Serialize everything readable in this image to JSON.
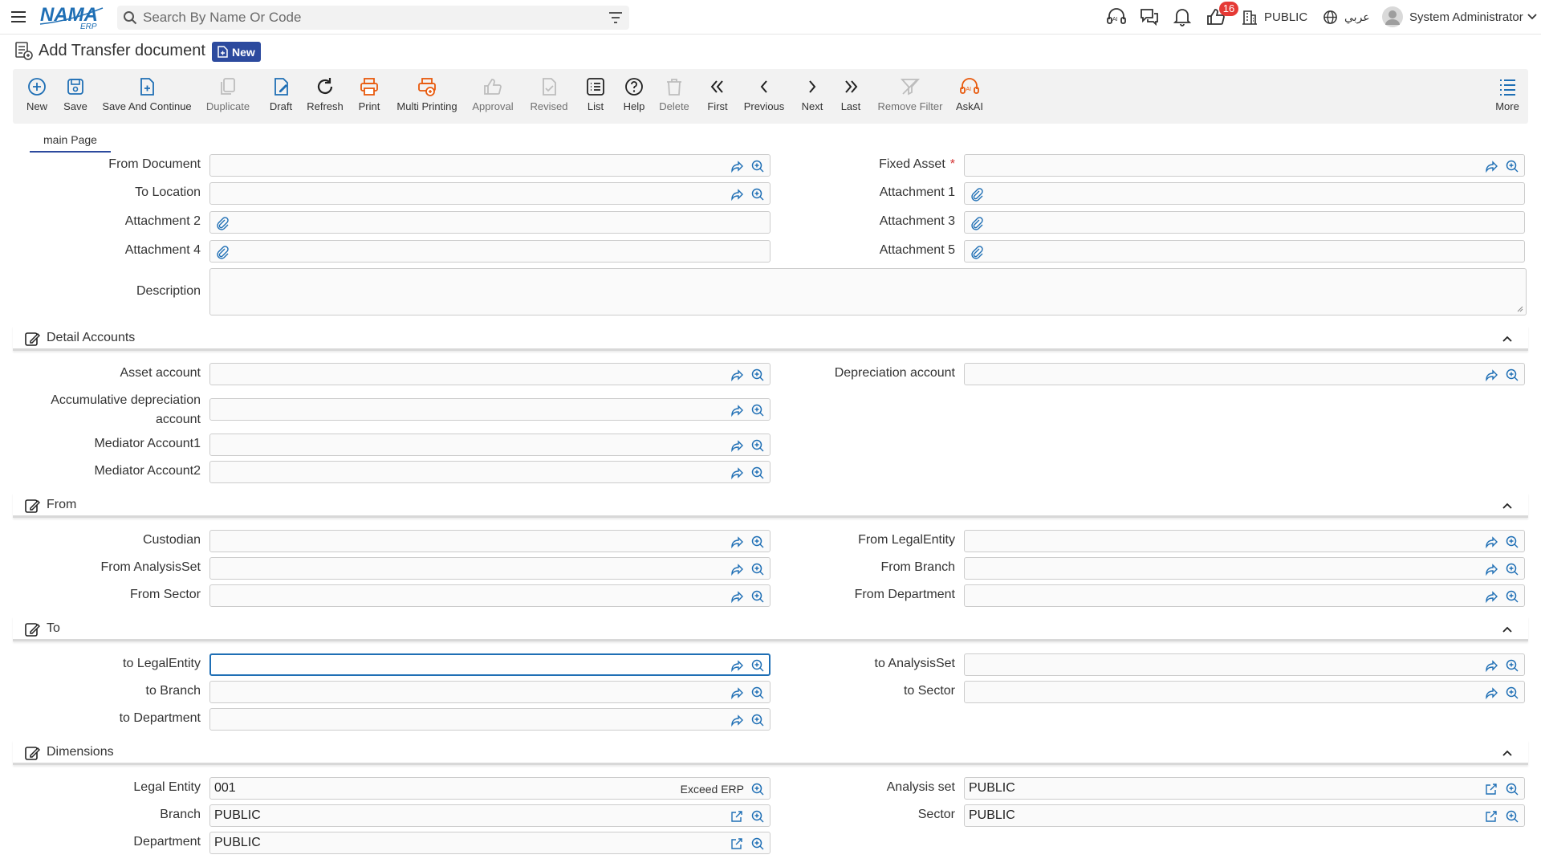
{
  "topbar": {
    "search_placeholder": "Search By Name Or Code",
    "notification_count": "16",
    "company": "PUBLIC",
    "language": "عربي",
    "user": "System Administrator"
  },
  "page": {
    "title": "Add Transfer document",
    "badge": "New"
  },
  "toolbar": [
    {
      "label": "New",
      "icon": "plus-circle-icon",
      "enabled": true
    },
    {
      "label": "Save",
      "icon": "save-icon",
      "enabled": true
    },
    {
      "label": "Save And Continue",
      "icon": "save-continue-icon",
      "enabled": true
    },
    {
      "label": "Duplicate",
      "icon": "duplicate-icon",
      "enabled": false
    },
    {
      "label": "Draft",
      "icon": "draft-icon",
      "enabled": true
    },
    {
      "label": "Refresh",
      "icon": "refresh-icon",
      "enabled": true
    },
    {
      "label": "Print",
      "icon": "print-icon",
      "enabled": true
    },
    {
      "label": "Multi Printing",
      "icon": "multi-print-icon",
      "enabled": true
    },
    {
      "label": "Approval",
      "icon": "thumbs-up-icon",
      "enabled": false
    },
    {
      "label": "Revised",
      "icon": "revised-icon",
      "enabled": false
    },
    {
      "label": "List",
      "icon": "list-icon",
      "enabled": true
    },
    {
      "label": "Help",
      "icon": "help-icon",
      "enabled": true
    },
    {
      "label": "Delete",
      "icon": "trash-icon",
      "enabled": false
    },
    {
      "label": "First",
      "icon": "first-icon",
      "enabled": true
    },
    {
      "label": "Previous",
      "icon": "previous-icon",
      "enabled": true
    },
    {
      "label": "Next",
      "icon": "next-icon",
      "enabled": true
    },
    {
      "label": "Last",
      "icon": "last-icon",
      "enabled": true
    },
    {
      "label": "Remove Filter",
      "icon": "remove-filter-icon",
      "enabled": false
    },
    {
      "label": "AskAI",
      "icon": "ai-icon",
      "enabled": true
    },
    {
      "label": "More",
      "icon": "more-icon",
      "enabled": true
    }
  ],
  "tab": "main Page",
  "main": {
    "from_document": "From Document",
    "fixed_asset": "Fixed Asset",
    "to_location": "To Location",
    "attachment1": "Attachment 1",
    "attachment2": "Attachment 2",
    "attachment3": "Attachment 3",
    "attachment4": "Attachment 4",
    "attachment5": "Attachment 5",
    "description": "Description"
  },
  "sections": {
    "detail": "Detail Accounts",
    "from": "From",
    "to": "To",
    "dimensions": "Dimensions"
  },
  "detail": {
    "asset_account": "Asset account",
    "depreciation_account": "Depreciation account",
    "accum_line1": "Accumulative depreciation",
    "accum_line2": "account",
    "mediator1": "Mediator Account1",
    "mediator2": "Mediator Account2"
  },
  "from": {
    "custodian": "Custodian",
    "legal_entity": "From LegalEntity",
    "analysis_set": "From AnalysisSet",
    "branch": "From Branch",
    "sector": "From Sector",
    "department": "From Department"
  },
  "to": {
    "legal_entity": "to LegalEntity",
    "analysis_set": "to AnalysisSet",
    "branch": "to Branch",
    "sector": "to Sector",
    "department": "to Department"
  },
  "dimensions": {
    "legal_entity_label": "Legal Entity",
    "legal_entity_value": "001",
    "legal_entity_name": "Exceed ERP",
    "analysis_set_label": "Analysis set",
    "analysis_set_value": "PUBLIC",
    "branch_label": "Branch",
    "branch_value": "PUBLIC",
    "sector_label": "Sector",
    "sector_value": "PUBLIC",
    "department_label": "Department",
    "department_value": "PUBLIC"
  }
}
